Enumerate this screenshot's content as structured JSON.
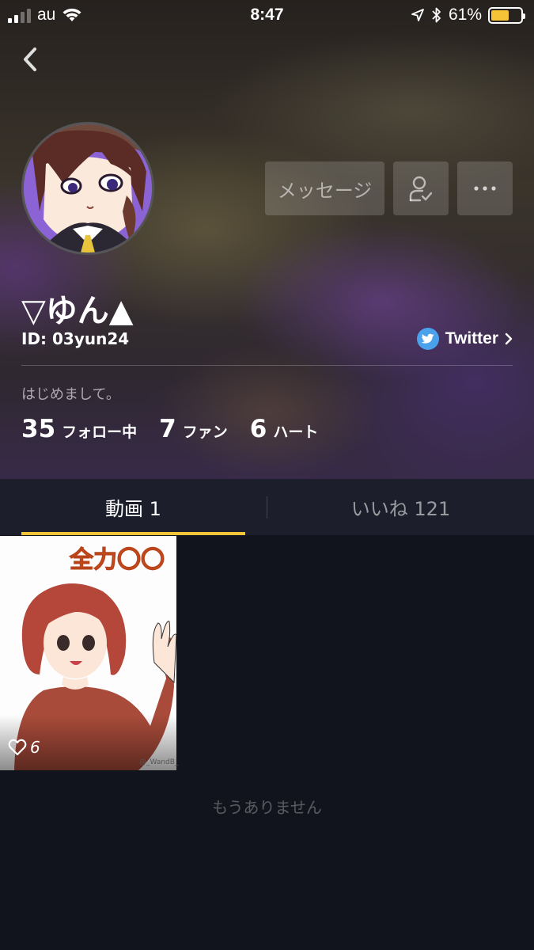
{
  "status_bar": {
    "carrier": "au",
    "time": "8:47",
    "battery_percent": "61%",
    "battery_level": 0.61,
    "battery_color": "#f5c437"
  },
  "nav": {
    "back_icon": "chevron-left-icon"
  },
  "profile": {
    "name": "▽ゆん▲",
    "id": "ID: 03yun24",
    "twitter_label": "Twitter",
    "bio": "はじめまして。",
    "stats": [
      {
        "num": "35",
        "label": "フォロー中"
      },
      {
        "num": "7",
        "label": "ファン"
      },
      {
        "num": "6",
        "label": "ハート"
      }
    ]
  },
  "actions": {
    "message_label": "メッセージ",
    "follow_icon": "user-check-icon",
    "more_icon": "more-horizontal-icon"
  },
  "tabs": [
    {
      "label": "動画 1",
      "active": true
    },
    {
      "label": "いいね 121",
      "active": false
    }
  ],
  "videos": [
    {
      "title_text": "全力〇〇",
      "likes": "6",
      "watermark": "@_WandB_"
    }
  ],
  "footer": {
    "no_more": "もうありません"
  },
  "colors": {
    "accent": "#f5c437",
    "background": "#12141d",
    "tab_bar": "#1c1f2b",
    "twitter": "#4aa1ec"
  }
}
